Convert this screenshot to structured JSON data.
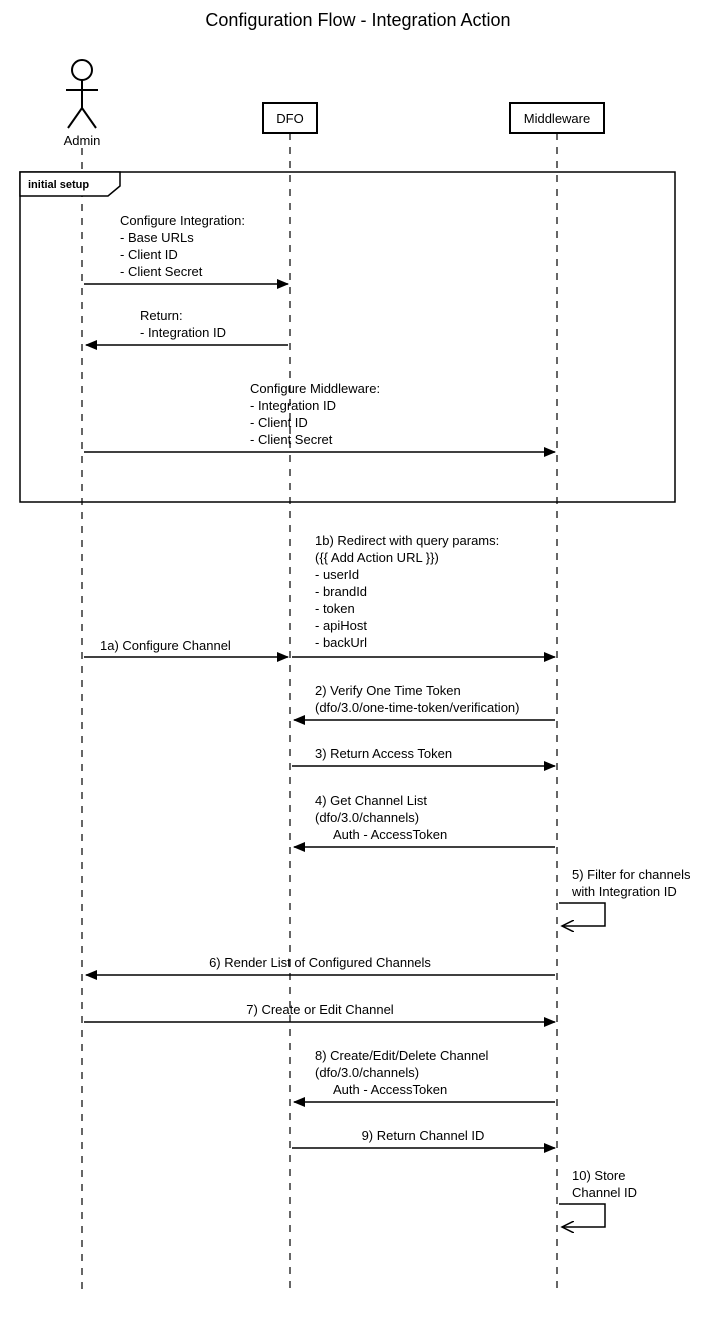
{
  "title": "Configuration Flow - Integration Action",
  "participants": {
    "admin": "Admin",
    "dfo": "DFO",
    "middleware": "Middleware"
  },
  "fragment": {
    "label": "initial setup"
  },
  "messages": {
    "m1": {
      "header": "Configure Integration:",
      "l1": "- Base URLs",
      "l2": "- Client ID",
      "l3": "- Client Secret"
    },
    "m2": {
      "header": "Return:",
      "l1": "  - Integration ID"
    },
    "m3": {
      "header": "Configure Middleware:",
      "l1": "- Integration ID",
      "l2": "- Client ID",
      "l3": "- Client Secret"
    },
    "m4a": "1a) Configure Channel",
    "m4b": {
      "header": "1b) Redirect with query params:",
      "sub": "({{ Add Action URL }})",
      "l1": "- userId",
      "l2": "- brandId",
      "l3": "- token",
      "l4": "- apiHost",
      "l5": "- backUrl"
    },
    "m5": {
      "header": "2) Verify One Time Token",
      "sub": "(dfo/3.0/one-time-token/verification)"
    },
    "m6": "3) Return Access Token",
    "m7": {
      "header": "4) Get Channel List",
      "sub": "(dfo/3.0/channels)",
      "auth": "Auth - AccessToken"
    },
    "m8": {
      "l1": "5) Filter for channels",
      "l2": "with Integration ID"
    },
    "m9": "6) Render List of Configured Channels",
    "m10": "7) Create or Edit Channel",
    "m11": {
      "header": "8) Create/Edit/Delete Channel",
      "sub": "(dfo/3.0/channels)",
      "auth": "Auth - AccessToken"
    },
    "m12": "9) Return Channel ID",
    "m13": {
      "l1": "10) Store",
      "l2": "Channel ID"
    }
  }
}
